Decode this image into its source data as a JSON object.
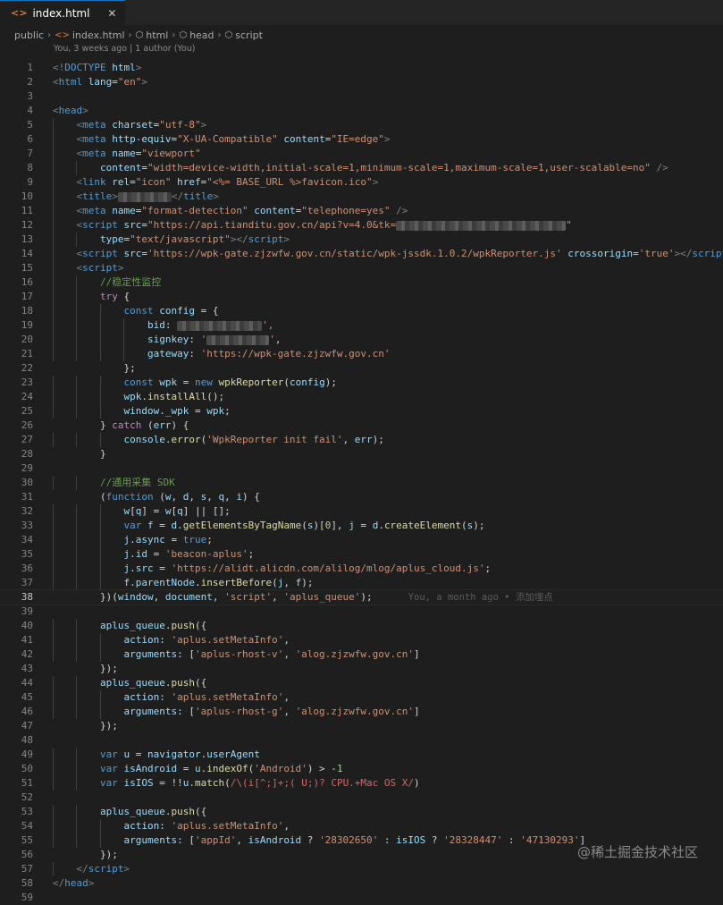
{
  "tab": {
    "label": "index.html",
    "icon": "html-file-icon",
    "close_glyph": "✕"
  },
  "breadcrumb": [
    "public",
    "index.html",
    "html",
    "head",
    "script"
  ],
  "blame_header": "You, 3 weeks ago | 1 author (You)",
  "active_line": 38,
  "inline_blame": "You, a month ago • 添加埋点",
  "watermark": "@稀土掘金技术社区",
  "code_lines": [
    [
      [
        "t-br",
        "<!"
      ],
      [
        "t-tag",
        "DOCTYPE"
      ],
      [
        "t-pl",
        " "
      ],
      [
        "t-attr",
        "html"
      ],
      [
        "t-br",
        ">"
      ]
    ],
    [
      [
        "t-br",
        "<"
      ],
      [
        "t-tag",
        "html"
      ],
      [
        "t-pl",
        " "
      ],
      [
        "t-attr",
        "lang"
      ],
      [
        "t-pl",
        "="
      ],
      [
        "t-str",
        "\"en\""
      ],
      [
        "t-br",
        ">"
      ]
    ],
    [],
    [
      [
        "t-br",
        "<"
      ],
      [
        "t-tag",
        "head"
      ],
      [
        "t-br",
        ">"
      ]
    ],
    [
      [
        "t-pl",
        "    "
      ],
      [
        "t-br",
        "<"
      ],
      [
        "t-tag",
        "meta"
      ],
      [
        "t-pl",
        " "
      ],
      [
        "t-attr",
        "charset"
      ],
      [
        "t-pl",
        "="
      ],
      [
        "t-str",
        "\"utf-8\""
      ],
      [
        "t-br",
        ">"
      ]
    ],
    [
      [
        "t-pl",
        "    "
      ],
      [
        "t-br",
        "<"
      ],
      [
        "t-tag",
        "meta"
      ],
      [
        "t-pl",
        " "
      ],
      [
        "t-attr",
        "http-equiv"
      ],
      [
        "t-pl",
        "="
      ],
      [
        "t-str",
        "\"X-UA-Compatible\""
      ],
      [
        "t-pl",
        " "
      ],
      [
        "t-attr",
        "content"
      ],
      [
        "t-pl",
        "="
      ],
      [
        "t-str",
        "\"IE=edge\""
      ],
      [
        "t-br",
        ">"
      ]
    ],
    [
      [
        "t-pl",
        "    "
      ],
      [
        "t-br",
        "<"
      ],
      [
        "t-tag",
        "meta"
      ],
      [
        "t-pl",
        " "
      ],
      [
        "t-attr",
        "name"
      ],
      [
        "t-pl",
        "="
      ],
      [
        "t-str",
        "\"viewport\""
      ]
    ],
    [
      [
        "t-pl",
        "        "
      ],
      [
        "t-attr",
        "content"
      ],
      [
        "t-pl",
        "="
      ],
      [
        "t-str",
        "\"width=device-width,initial-scale=1,minimum-scale=1,maximum-scale=1,user-scalable=no\""
      ],
      [
        "t-pl",
        " "
      ],
      [
        "t-br",
        "/>"
      ]
    ],
    [
      [
        "t-pl",
        "    "
      ],
      [
        "t-br",
        "<"
      ],
      [
        "t-tag",
        "link"
      ],
      [
        "t-pl",
        " "
      ],
      [
        "t-attr",
        "rel"
      ],
      [
        "t-pl",
        "="
      ],
      [
        "t-str",
        "\"icon\""
      ],
      [
        "t-pl",
        " "
      ],
      [
        "t-attr",
        "href"
      ],
      [
        "t-pl",
        "="
      ],
      [
        "t-str",
        "\"<%= BASE_URL %>favicon.ico\""
      ],
      [
        "t-br",
        ">"
      ]
    ],
    [
      [
        "t-pl",
        "    "
      ],
      [
        "t-br",
        "<"
      ],
      [
        "t-tag",
        "title"
      ],
      [
        "t-br",
        ">"
      ],
      [
        "blur",
        ""
      ],
      [
        "t-br",
        "</"
      ],
      [
        "t-tag",
        "title"
      ],
      [
        "t-br",
        ">"
      ]
    ],
    [
      [
        "t-pl",
        "    "
      ],
      [
        "t-br",
        "<"
      ],
      [
        "t-tag",
        "meta"
      ],
      [
        "t-pl",
        " "
      ],
      [
        "t-attr",
        "name"
      ],
      [
        "t-pl",
        "="
      ],
      [
        "t-str",
        "\"format-detection\""
      ],
      [
        "t-pl",
        " "
      ],
      [
        "t-attr",
        "content"
      ],
      [
        "t-pl",
        "="
      ],
      [
        "t-str",
        "\"telephone=yes\""
      ],
      [
        "t-pl",
        " "
      ],
      [
        "t-br",
        "/>"
      ]
    ],
    [
      [
        "t-pl",
        "    "
      ],
      [
        "t-br",
        "<"
      ],
      [
        "t-tag",
        "script"
      ],
      [
        "t-pl",
        " "
      ],
      [
        "t-attr",
        "src"
      ],
      [
        "t-pl",
        "="
      ],
      [
        "t-str",
        "\"https://api.tianditu.gov.cn/api?v=4.0&tk="
      ],
      [
        "blur",
        ""
      ],
      [
        "t-str",
        "\""
      ]
    ],
    [
      [
        "t-pl",
        "        "
      ],
      [
        "t-attr",
        "type"
      ],
      [
        "t-pl",
        "="
      ],
      [
        "t-str",
        "\"text/javascript\""
      ],
      [
        "t-br",
        "></"
      ],
      [
        "t-tag",
        "script"
      ],
      [
        "t-br",
        ">"
      ]
    ],
    [
      [
        "t-pl",
        "    "
      ],
      [
        "t-br",
        "<"
      ],
      [
        "t-tag",
        "script"
      ],
      [
        "t-pl",
        " "
      ],
      [
        "t-attr",
        "src"
      ],
      [
        "t-pl",
        "="
      ],
      [
        "t-str",
        "'https://wpk-gate.zjzwfw.gov.cn/static/wpk-jssdk.1.0.2/wpkReporter.js'"
      ],
      [
        "t-pl",
        " "
      ],
      [
        "t-attr",
        "crossorigin"
      ],
      [
        "t-pl",
        "="
      ],
      [
        "t-str",
        "'true'"
      ],
      [
        "t-br",
        "></"
      ],
      [
        "t-tag",
        "script"
      ],
      [
        "t-br",
        ">"
      ]
    ],
    [
      [
        "t-pl",
        "    "
      ],
      [
        "t-br",
        "<"
      ],
      [
        "t-tag",
        "script"
      ],
      [
        "t-br",
        ">"
      ]
    ],
    [
      [
        "t-pl",
        "        "
      ],
      [
        "t-com",
        "//稳定性监控"
      ]
    ],
    [
      [
        "t-pl",
        "        "
      ],
      [
        "t-ctrl",
        "try"
      ],
      [
        "t-pl",
        " {"
      ]
    ],
    [
      [
        "t-pl",
        "            "
      ],
      [
        "t-kw",
        "const"
      ],
      [
        "t-pl",
        " "
      ],
      [
        "t-var",
        "config"
      ],
      [
        "t-pl",
        " = {"
      ]
    ],
    [
      [
        "t-pl",
        "                "
      ],
      [
        "t-var",
        "bid"
      ],
      [
        "t-pl",
        ": "
      ],
      [
        "blur",
        ""
      ],
      [
        "t-str",
        "',"
      ]
    ],
    [
      [
        "t-pl",
        "                "
      ],
      [
        "t-var",
        "signkey"
      ],
      [
        "t-pl",
        ": "
      ],
      [
        "t-str",
        "'"
      ],
      [
        "blur",
        ""
      ],
      [
        "t-str",
        "'"
      ],
      [
        "t-pl",
        ","
      ]
    ],
    [
      [
        "t-pl",
        "                "
      ],
      [
        "t-var",
        "gateway"
      ],
      [
        "t-pl",
        ": "
      ],
      [
        "t-str",
        "'https://wpk-gate.zjzwfw.gov.cn'"
      ]
    ],
    [
      [
        "t-pl",
        "            };"
      ]
    ],
    [
      [
        "t-pl",
        "            "
      ],
      [
        "t-kw",
        "const"
      ],
      [
        "t-pl",
        " "
      ],
      [
        "t-var",
        "wpk"
      ],
      [
        "t-pl",
        " = "
      ],
      [
        "t-kw",
        "new"
      ],
      [
        "t-pl",
        " "
      ],
      [
        "t-fn",
        "wpkReporter"
      ],
      [
        "t-pl",
        "("
      ],
      [
        "t-var",
        "config"
      ],
      [
        "t-pl",
        ");"
      ]
    ],
    [
      [
        "t-pl",
        "            "
      ],
      [
        "t-var",
        "wpk"
      ],
      [
        "t-pl",
        "."
      ],
      [
        "t-fn",
        "installAll"
      ],
      [
        "t-pl",
        "();"
      ]
    ],
    [
      [
        "t-pl",
        "            "
      ],
      [
        "t-var",
        "window"
      ],
      [
        "t-pl",
        "."
      ],
      [
        "t-var",
        "_wpk"
      ],
      [
        "t-pl",
        " = "
      ],
      [
        "t-var",
        "wpk"
      ],
      [
        "t-pl",
        ";"
      ]
    ],
    [
      [
        "t-pl",
        "        } "
      ],
      [
        "t-ctrl",
        "catch"
      ],
      [
        "t-pl",
        " ("
      ],
      [
        "t-var",
        "err"
      ],
      [
        "t-pl",
        ") {"
      ]
    ],
    [
      [
        "t-pl",
        "            "
      ],
      [
        "t-var",
        "console"
      ],
      [
        "t-pl",
        "."
      ],
      [
        "t-fn",
        "error"
      ],
      [
        "t-pl",
        "("
      ],
      [
        "t-str",
        "'WpkReporter init fail'"
      ],
      [
        "t-pl",
        ", "
      ],
      [
        "t-var",
        "err"
      ],
      [
        "t-pl",
        ");"
      ]
    ],
    [
      [
        "t-pl",
        "        }"
      ]
    ],
    [],
    [
      [
        "t-pl",
        "        "
      ],
      [
        "t-com",
        "//通用采集 SDK"
      ]
    ],
    [
      [
        "t-pl",
        "        ("
      ],
      [
        "t-kw",
        "function"
      ],
      [
        "t-pl",
        " ("
      ],
      [
        "t-var",
        "w"
      ],
      [
        "t-pl",
        ", "
      ],
      [
        "t-var",
        "d"
      ],
      [
        "t-pl",
        ", "
      ],
      [
        "t-var",
        "s"
      ],
      [
        "t-pl",
        ", "
      ],
      [
        "t-var",
        "q"
      ],
      [
        "t-pl",
        ", "
      ],
      [
        "t-var",
        "i"
      ],
      [
        "t-pl",
        ") {"
      ]
    ],
    [
      [
        "t-pl",
        "            "
      ],
      [
        "t-var",
        "w"
      ],
      [
        "t-pl",
        "["
      ],
      [
        "t-var",
        "q"
      ],
      [
        "t-pl",
        "] = "
      ],
      [
        "t-var",
        "w"
      ],
      [
        "t-pl",
        "["
      ],
      [
        "t-var",
        "q"
      ],
      [
        "t-pl",
        "] || [];"
      ]
    ],
    [
      [
        "t-pl",
        "            "
      ],
      [
        "t-kw",
        "var"
      ],
      [
        "t-pl",
        " "
      ],
      [
        "t-var",
        "f"
      ],
      [
        "t-pl",
        " = "
      ],
      [
        "t-var",
        "d"
      ],
      [
        "t-pl",
        "."
      ],
      [
        "t-fn",
        "getElementsByTagName"
      ],
      [
        "t-pl",
        "("
      ],
      [
        "t-var",
        "s"
      ],
      [
        "t-pl",
        ")["
      ],
      [
        "t-num",
        "0"
      ],
      [
        "t-pl",
        "], "
      ],
      [
        "t-var",
        "j"
      ],
      [
        "t-pl",
        " = "
      ],
      [
        "t-var",
        "d"
      ],
      [
        "t-pl",
        "."
      ],
      [
        "t-fn",
        "createElement"
      ],
      [
        "t-pl",
        "("
      ],
      [
        "t-var",
        "s"
      ],
      [
        "t-pl",
        ");"
      ]
    ],
    [
      [
        "t-pl",
        "            "
      ],
      [
        "t-var",
        "j"
      ],
      [
        "t-pl",
        "."
      ],
      [
        "t-var",
        "async"
      ],
      [
        "t-pl",
        " = "
      ],
      [
        "t-kw",
        "true"
      ],
      [
        "t-pl",
        ";"
      ]
    ],
    [
      [
        "t-pl",
        "            "
      ],
      [
        "t-var",
        "j"
      ],
      [
        "t-pl",
        "."
      ],
      [
        "t-var",
        "id"
      ],
      [
        "t-pl",
        " = "
      ],
      [
        "t-str",
        "'beacon-aplus'"
      ],
      [
        "t-pl",
        ";"
      ]
    ],
    [
      [
        "t-pl",
        "            "
      ],
      [
        "t-var",
        "j"
      ],
      [
        "t-pl",
        "."
      ],
      [
        "t-var",
        "src"
      ],
      [
        "t-pl",
        " = "
      ],
      [
        "t-str",
        "'https://alidt.alicdn.com/alilog/mlog/aplus_cloud.js'"
      ],
      [
        "t-pl",
        ";"
      ]
    ],
    [
      [
        "t-pl",
        "            "
      ],
      [
        "t-var",
        "f"
      ],
      [
        "t-pl",
        "."
      ],
      [
        "t-var",
        "parentNode"
      ],
      [
        "t-pl",
        "."
      ],
      [
        "t-fn",
        "insertBefore"
      ],
      [
        "t-pl",
        "("
      ],
      [
        "t-var",
        "j"
      ],
      [
        "t-pl",
        ", "
      ],
      [
        "t-var",
        "f"
      ],
      [
        "t-pl",
        ");"
      ]
    ],
    [
      [
        "t-pl",
        "        })("
      ],
      [
        "t-var",
        "window"
      ],
      [
        "t-pl",
        ", "
      ],
      [
        "t-var",
        "document"
      ],
      [
        "t-pl",
        ", "
      ],
      [
        "t-str",
        "'script'"
      ],
      [
        "t-pl",
        ", "
      ],
      [
        "t-str",
        "'aplus_queue'"
      ],
      [
        "t-pl",
        ");"
      ]
    ],
    [],
    [
      [
        "t-pl",
        "        "
      ],
      [
        "t-var",
        "aplus_queue"
      ],
      [
        "t-pl",
        "."
      ],
      [
        "t-fn",
        "push"
      ],
      [
        "t-pl",
        "({"
      ]
    ],
    [
      [
        "t-pl",
        "            "
      ],
      [
        "t-var",
        "action"
      ],
      [
        "t-pl",
        ": "
      ],
      [
        "t-str",
        "'aplus.setMetaInfo'"
      ],
      [
        "t-pl",
        ","
      ]
    ],
    [
      [
        "t-pl",
        "            "
      ],
      [
        "t-var",
        "arguments"
      ],
      [
        "t-pl",
        ": ["
      ],
      [
        "t-str",
        "'aplus-rhost-v'"
      ],
      [
        "t-pl",
        ", "
      ],
      [
        "t-str",
        "'alog.zjzwfw.gov.cn'"
      ],
      [
        "t-pl",
        "]"
      ]
    ],
    [
      [
        "t-pl",
        "        });"
      ]
    ],
    [
      [
        "t-pl",
        "        "
      ],
      [
        "t-var",
        "aplus_queue"
      ],
      [
        "t-pl",
        "."
      ],
      [
        "t-fn",
        "push"
      ],
      [
        "t-pl",
        "({"
      ]
    ],
    [
      [
        "t-pl",
        "            "
      ],
      [
        "t-var",
        "action"
      ],
      [
        "t-pl",
        ": "
      ],
      [
        "t-str",
        "'aplus.setMetaInfo'"
      ],
      [
        "t-pl",
        ","
      ]
    ],
    [
      [
        "t-pl",
        "            "
      ],
      [
        "t-var",
        "arguments"
      ],
      [
        "t-pl",
        ": ["
      ],
      [
        "t-str",
        "'aplus-rhost-g'"
      ],
      [
        "t-pl",
        ", "
      ],
      [
        "t-str",
        "'alog.zjzwfw.gov.cn'"
      ],
      [
        "t-pl",
        "]"
      ]
    ],
    [
      [
        "t-pl",
        "        });"
      ]
    ],
    [],
    [
      [
        "t-pl",
        "        "
      ],
      [
        "t-kw",
        "var"
      ],
      [
        "t-pl",
        " "
      ],
      [
        "t-var",
        "u"
      ],
      [
        "t-pl",
        " = "
      ],
      [
        "t-var",
        "navigator"
      ],
      [
        "t-pl",
        "."
      ],
      [
        "t-var",
        "userAgent"
      ]
    ],
    [
      [
        "t-pl",
        "        "
      ],
      [
        "t-kw",
        "var"
      ],
      [
        "t-pl",
        " "
      ],
      [
        "t-var",
        "isAndroid"
      ],
      [
        "t-pl",
        " = "
      ],
      [
        "t-var",
        "u"
      ],
      [
        "t-pl",
        "."
      ],
      [
        "t-fn",
        "indexOf"
      ],
      [
        "t-pl",
        "("
      ],
      [
        "t-str",
        "'Android'"
      ],
      [
        "t-pl",
        ") > -"
      ],
      [
        "t-num",
        "1"
      ]
    ],
    [
      [
        "t-pl",
        "        "
      ],
      [
        "t-kw",
        "var"
      ],
      [
        "t-pl",
        " "
      ],
      [
        "t-var",
        "isIOS"
      ],
      [
        "t-pl",
        " = !!"
      ],
      [
        "t-var",
        "u"
      ],
      [
        "t-pl",
        "."
      ],
      [
        "t-fn",
        "match"
      ],
      [
        "t-pl",
        "("
      ],
      [
        "t-rx",
        "/\\(i[^;]+;( U;)? CPU.+Mac OS X/"
      ],
      [
        "t-pl",
        ")"
      ]
    ],
    [],
    [
      [
        "t-pl",
        "        "
      ],
      [
        "t-var",
        "aplus_queue"
      ],
      [
        "t-pl",
        "."
      ],
      [
        "t-fn",
        "push"
      ],
      [
        "t-pl",
        "({"
      ]
    ],
    [
      [
        "t-pl",
        "            "
      ],
      [
        "t-var",
        "action"
      ],
      [
        "t-pl",
        ": "
      ],
      [
        "t-str",
        "'aplus.setMetaInfo'"
      ],
      [
        "t-pl",
        ","
      ]
    ],
    [
      [
        "t-pl",
        "            "
      ],
      [
        "t-var",
        "arguments"
      ],
      [
        "t-pl",
        ": ["
      ],
      [
        "t-str",
        "'appId'"
      ],
      [
        "t-pl",
        ", "
      ],
      [
        "t-var",
        "isAndroid"
      ],
      [
        "t-pl",
        " ? "
      ],
      [
        "t-str",
        "'28302650'"
      ],
      [
        "t-pl",
        " : "
      ],
      [
        "t-var",
        "isIOS"
      ],
      [
        "t-pl",
        " ? "
      ],
      [
        "t-str",
        "'28328447'"
      ],
      [
        "t-pl",
        " : "
      ],
      [
        "t-str",
        "'47130293'"
      ],
      [
        "t-pl",
        "]"
      ]
    ],
    [
      [
        "t-pl",
        "        });"
      ]
    ],
    [
      [
        "t-pl",
        "    "
      ],
      [
        "t-br",
        "</"
      ],
      [
        "t-tag",
        "script"
      ],
      [
        "t-br",
        ">"
      ]
    ],
    [
      [
        "t-br",
        "</"
      ],
      [
        "t-tag",
        "head"
      ],
      [
        "t-br",
        ">"
      ]
    ],
    []
  ]
}
